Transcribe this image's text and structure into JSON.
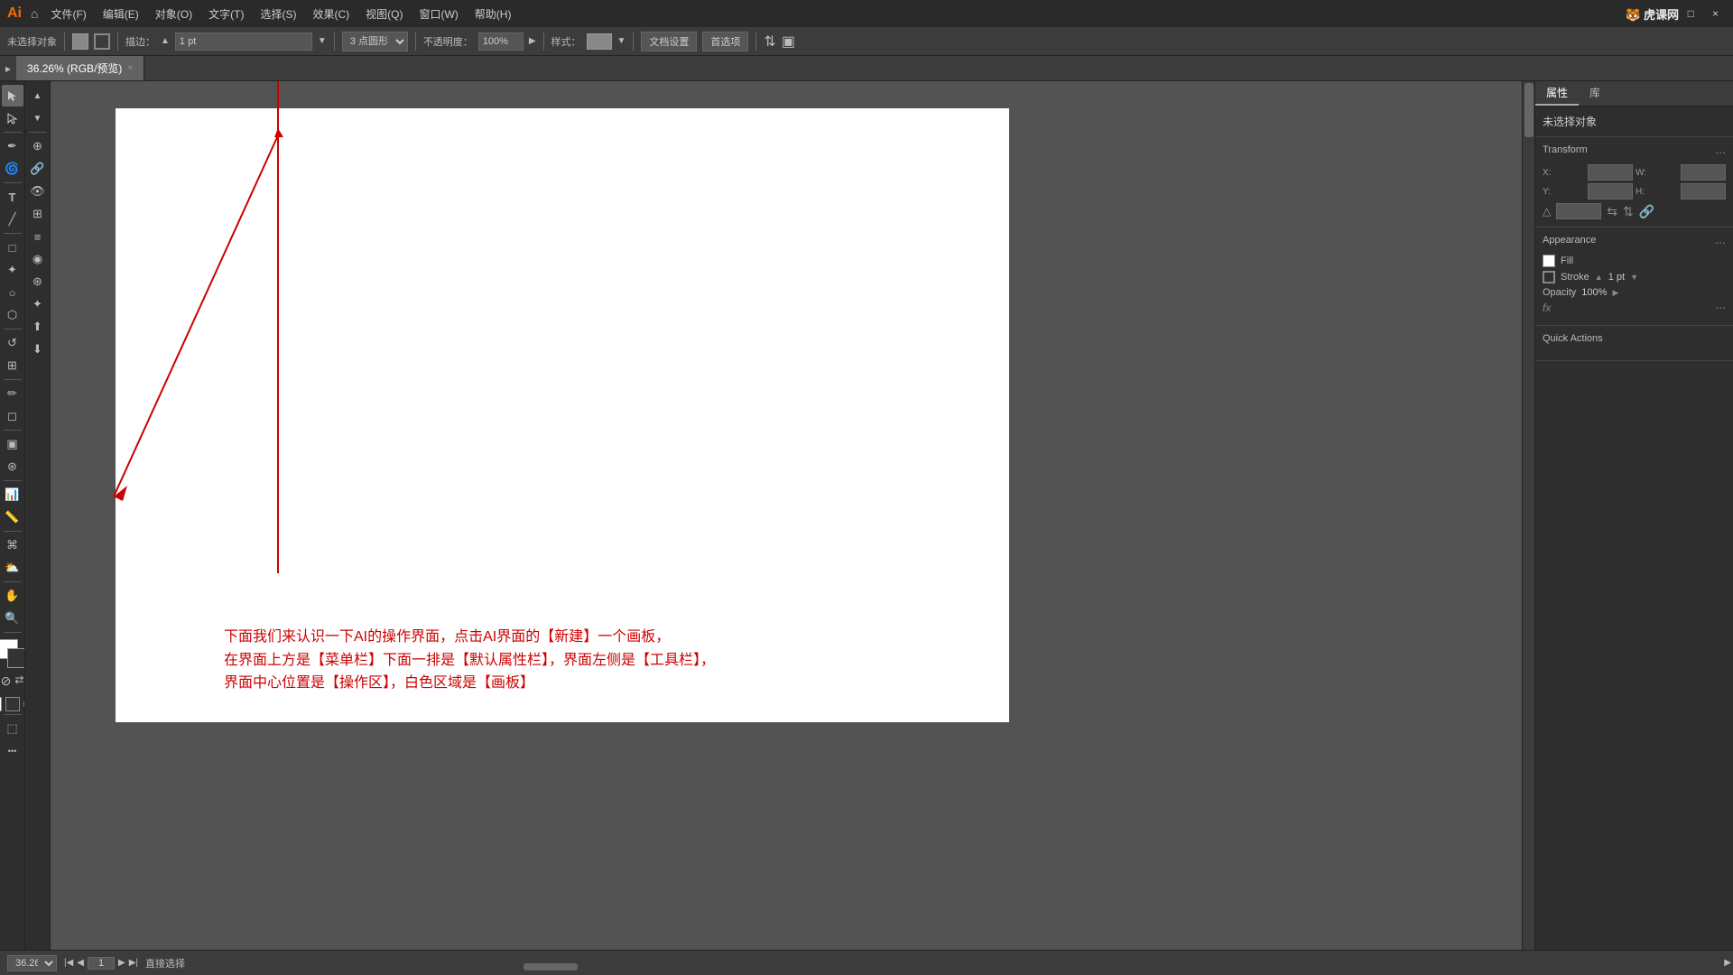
{
  "titlebar": {
    "logo": "Ai",
    "menus": [
      "文件(F)",
      "编辑(E)",
      "对象(O)",
      "文字(T)",
      "选择(S)",
      "效果(C)",
      "视图(Q)",
      "窗口(W)",
      "帮助(H)"
    ],
    "watermark": "虎课网",
    "window_controls": [
      "—",
      "□",
      "×"
    ]
  },
  "optionsbar": {
    "no_selection": "未选择对象",
    "stroke_label": "描边：",
    "stroke_value": "1 pt",
    "point_label": "3 点圆形",
    "opacity_label": "不透明度：",
    "opacity_value": "100%",
    "style_label": "样式：",
    "doc_settings": "文档设置",
    "preferences": "首选项"
  },
  "tabs": [
    {
      "label": "36.26% (RGB/预览)",
      "active": true
    }
  ],
  "canvas": {
    "artboard_visible": true
  },
  "annotation": {
    "line1": "下面我们来认识一下AI的操作界面，点击AI界面的【新建】一个画板，",
    "line2": "在界面上方是【菜单栏】下面一排是【默认属性栏】，界面左侧是【工具栏】，",
    "line3": "界面中心位置是【操作区】，白色区域是【画板】"
  },
  "rightpanel": {
    "tabs": [
      "属性",
      "库"
    ],
    "no_selection": "未选择对象",
    "transform_title": "Transform",
    "x_label": "X:",
    "y_label": "Y:",
    "w_label": "W:",
    "h_label": "H:",
    "appearance_title": "Appearance",
    "fill_label": "Fill",
    "stroke_label": "Stroke",
    "stroke_value": "1 pt",
    "opacity_label": "Opacity",
    "opacity_value": "100%",
    "quick_actions": "Quick Actions"
  },
  "statusbar": {
    "zoom_value": "36.26%",
    "page_label": "1",
    "direct_select": "直接选择"
  },
  "toolbar_tools": [
    "▸",
    "▸",
    "✎",
    "✿",
    "T",
    "/",
    "□",
    "✦",
    "○",
    "⬡",
    "✂",
    "⊕",
    "◎",
    "≡",
    "📊",
    "✏",
    "✱",
    "☁",
    "✋",
    "🔍"
  ]
}
